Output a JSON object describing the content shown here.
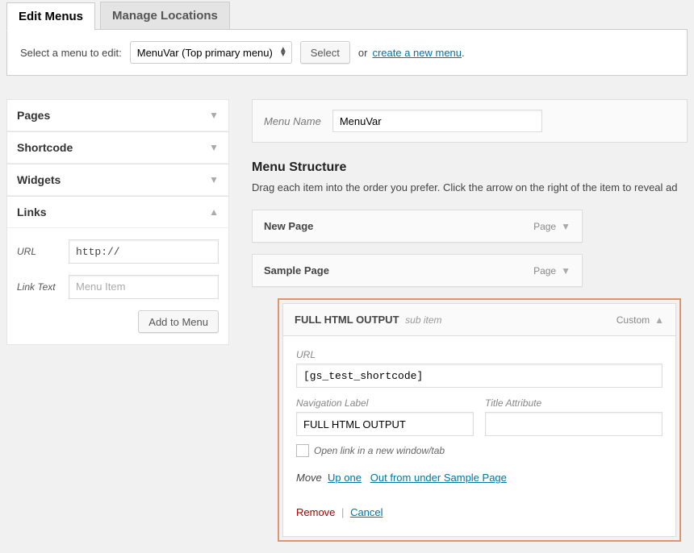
{
  "tabs": {
    "edit": "Edit Menus",
    "manage": "Manage Locations"
  },
  "selectRow": {
    "label": "Select a menu to edit:",
    "options": [
      "MenuVar (Top primary menu)"
    ],
    "selectBtn": "Select",
    "or": "or",
    "createLink": "create a new menu"
  },
  "sidebar": {
    "pages": "Pages",
    "shortcode": "Shortcode",
    "widgets": "Widgets",
    "links": "Links",
    "urlLabel": "URL",
    "urlValue": "http://",
    "linkTextLabel": "Link Text",
    "linkTextPlaceholder": "Menu Item",
    "addBtn": "Add to Menu"
  },
  "menuNameLabel": "Menu Name",
  "menuNameValue": "MenuVar",
  "structureHeading": "Menu Structure",
  "structureHint": "Drag each item into the order you prefer. Click the arrow on the right of the item to reveal ad",
  "items": {
    "newPage": {
      "title": "New Page",
      "type": "Page"
    },
    "samplePage": {
      "title": "Sample Page",
      "type": "Page"
    },
    "fullHtml": {
      "title": "FULL HTML OUTPUT",
      "subtitle": "sub item",
      "type": "Custom",
      "urlLabel": "URL",
      "urlValue": "[gs_test_shortcode]",
      "navLabel": "Navigation Label",
      "navValue": "FULL HTML OUTPUT",
      "titleAttrLabel": "Title Attribute",
      "titleAttrValue": "",
      "openNewTab": "Open link in a new window/tab",
      "moveLabel": "Move",
      "upOne": "Up one",
      "outFrom": "Out from under Sample Page",
      "remove": "Remove",
      "cancel": "Cancel"
    }
  }
}
